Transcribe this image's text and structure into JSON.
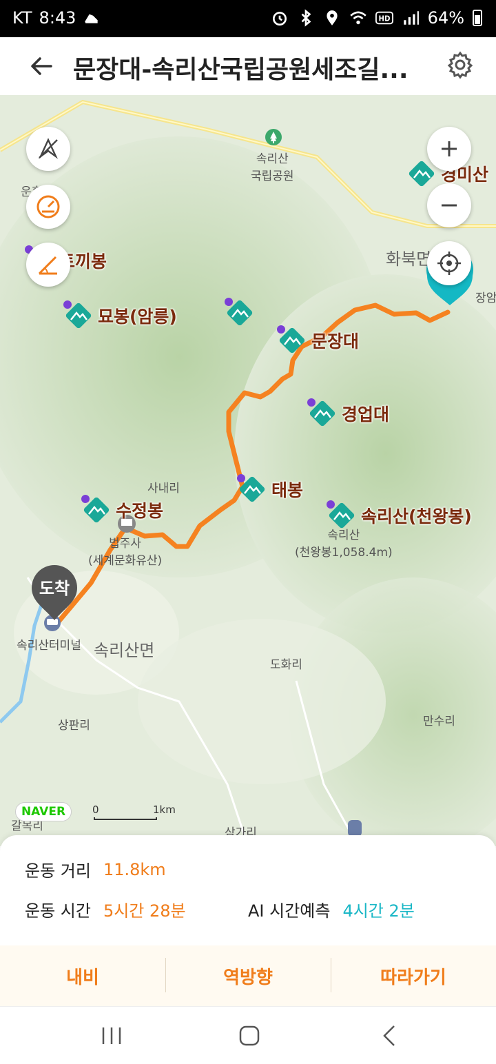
{
  "status_bar": {
    "carrier": "KT",
    "time": "8:43",
    "battery": "64%",
    "icons": [
      "shoe-icon",
      "alarm-icon",
      "bluetooth-icon",
      "location-icon",
      "wifi-icon",
      "hd-icon",
      "signal-icon",
      "battery-icon"
    ]
  },
  "header": {
    "title": "문장대-속리산국립공원세조길...",
    "back_icon": "arrow-left-icon",
    "settings_icon": "gear-icon"
  },
  "map": {
    "labels": {
      "national_park_1": "속리산",
      "national_park_2": "국립공원",
      "hwabuk": "화북면",
      "jangam": "장암",
      "sanaeri": "사내리",
      "beopjusa_1": "법주사",
      "beopjusa_2": "(세계문화유산)",
      "terminal": "속리산터미널",
      "songnisan_myeon": "속리산면",
      "dohwari": "도화리",
      "sangpanri": "상판리",
      "mansuri": "만수리",
      "samgari": "삼가리",
      "galmok": "갈목리",
      "unheung": "운흥리",
      "cheonwang_1": "속리산",
      "cheonwang_2": "(천왕봉1,058.4m)"
    },
    "peaks": {
      "tokkibong": "토끼봉",
      "myobong": "묘봉(암릉)",
      "munjangdae": "문장대",
      "gyeongeopdae": "경업대",
      "taebong": "태봉",
      "sujeongbong": "수정봉",
      "cheonwangbong": "속리산(천왕봉)",
      "gyeongmisan": "경미산"
    },
    "arrive_pin": "도착",
    "naver_logo": "NAVER",
    "scale_start": "0",
    "scale_end": "1km",
    "route_color": "#f58220",
    "peak_color": "#1aa898"
  },
  "sheet": {
    "distance_label": "운동 거리",
    "distance_value": "11.8km",
    "time_label": "운동 시간",
    "time_value": "5시간 28분",
    "ai_label": "AI 시간예측",
    "ai_value": "4시간 2분",
    "actions": [
      "내비",
      "역방향",
      "따라가기"
    ]
  }
}
